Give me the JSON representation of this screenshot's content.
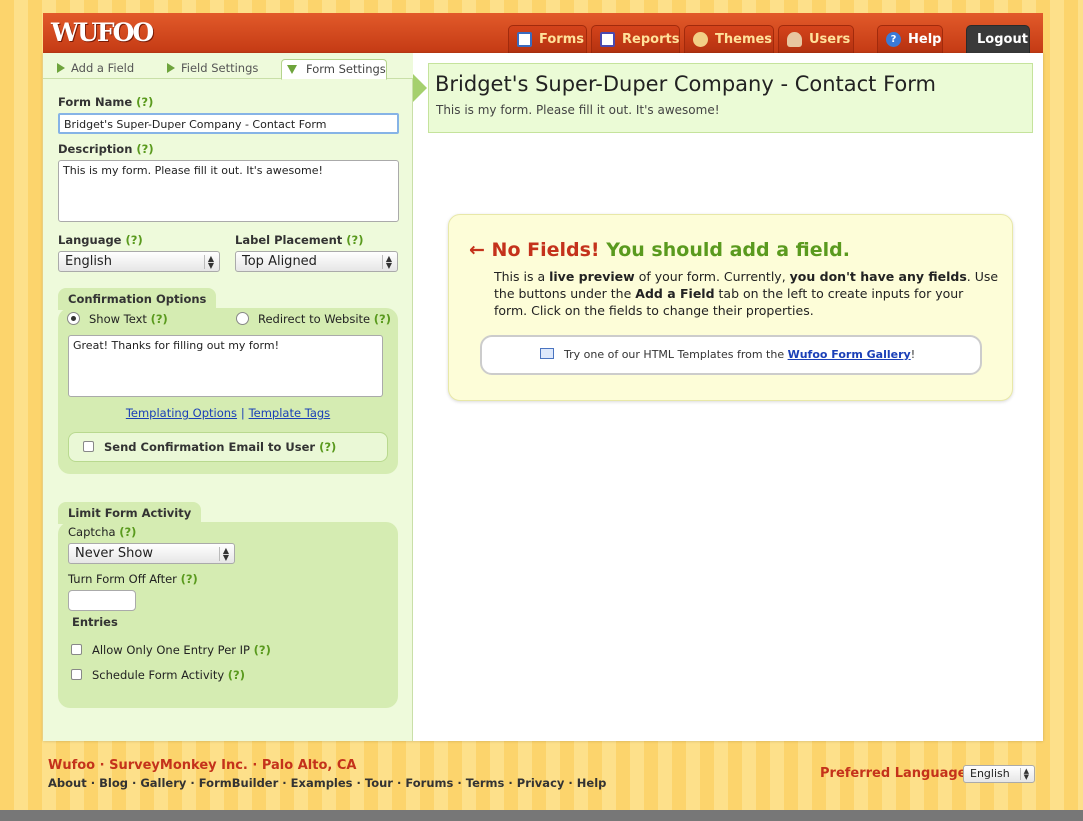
{
  "logo": "WUFOO",
  "nav": {
    "forms": "Forms",
    "reports": "Reports",
    "themes": "Themes",
    "users": "Users",
    "help": "Help",
    "logout": "Logout"
  },
  "left_tabs": {
    "add_field": "Add a Field",
    "field_settings": "Field Settings",
    "form_settings": "Form Settings"
  },
  "form": {
    "name_label": "Form Name",
    "q": "(?)",
    "name_value": "Bridget's Super-Duper Company - Contact Form",
    "desc_label": "Description",
    "desc_value": "This is my form. Please fill it out. It's awesome!",
    "language_label": "Language",
    "language_value": "English",
    "placement_label": "Label Placement",
    "placement_value": "Top Aligned"
  },
  "confirmation": {
    "title": "Confirmation Options",
    "show_text": "Show Text",
    "redirect": "Redirect to Website",
    "message": "Great! Thanks for filling out my form!",
    "templating": "Templating Options",
    "sep": "|",
    "template_tags": "Template Tags",
    "send_email": "Send Confirmation Email to User"
  },
  "limit": {
    "title": "Limit Form Activity",
    "captcha_label": "Captcha",
    "captcha_value": "Never Show",
    "turnoff_label": "Turn Form Off After",
    "entries": "Entries",
    "one_entry": "Allow Only One Entry Per IP",
    "schedule": "Schedule Form Activity"
  },
  "preview": {
    "title": "Bridget's Super-Duper Company - Contact Form",
    "desc": "This is my form. Please fill it out. It's awesome!"
  },
  "notice": {
    "arrow": "←",
    "nofields": "No Fields!",
    "add": "You should add a field.",
    "t1": "This is a ",
    "b1": "live preview",
    "t2": " of your form. Currently, ",
    "b2": "you don't have any fields",
    "t3": ". Use the buttons under the ",
    "b3": "Add a Field",
    "t4": " tab on the left to create inputs for your form. Click on the fields to change their properties.",
    "gallery_text": "Try one of our HTML Templates from the ",
    "gallery_link": "Wufoo Form Gallery",
    "gallery_end": "!"
  },
  "footer": {
    "company": "Wufoo · SurveyMonkey Inc. · Palo Alto, CA",
    "links": [
      "About",
      "Blog",
      "Gallery",
      "FormBuilder",
      "Examples",
      "Tour",
      "Forums",
      "Terms",
      "Privacy",
      "Help"
    ],
    "dot": "·",
    "pref_label": "Preferred Language :",
    "pref_value": "English"
  },
  "colors": {
    "accent": "#c43a14",
    "green": "#5a9a1e",
    "panel": "#eefadb"
  }
}
